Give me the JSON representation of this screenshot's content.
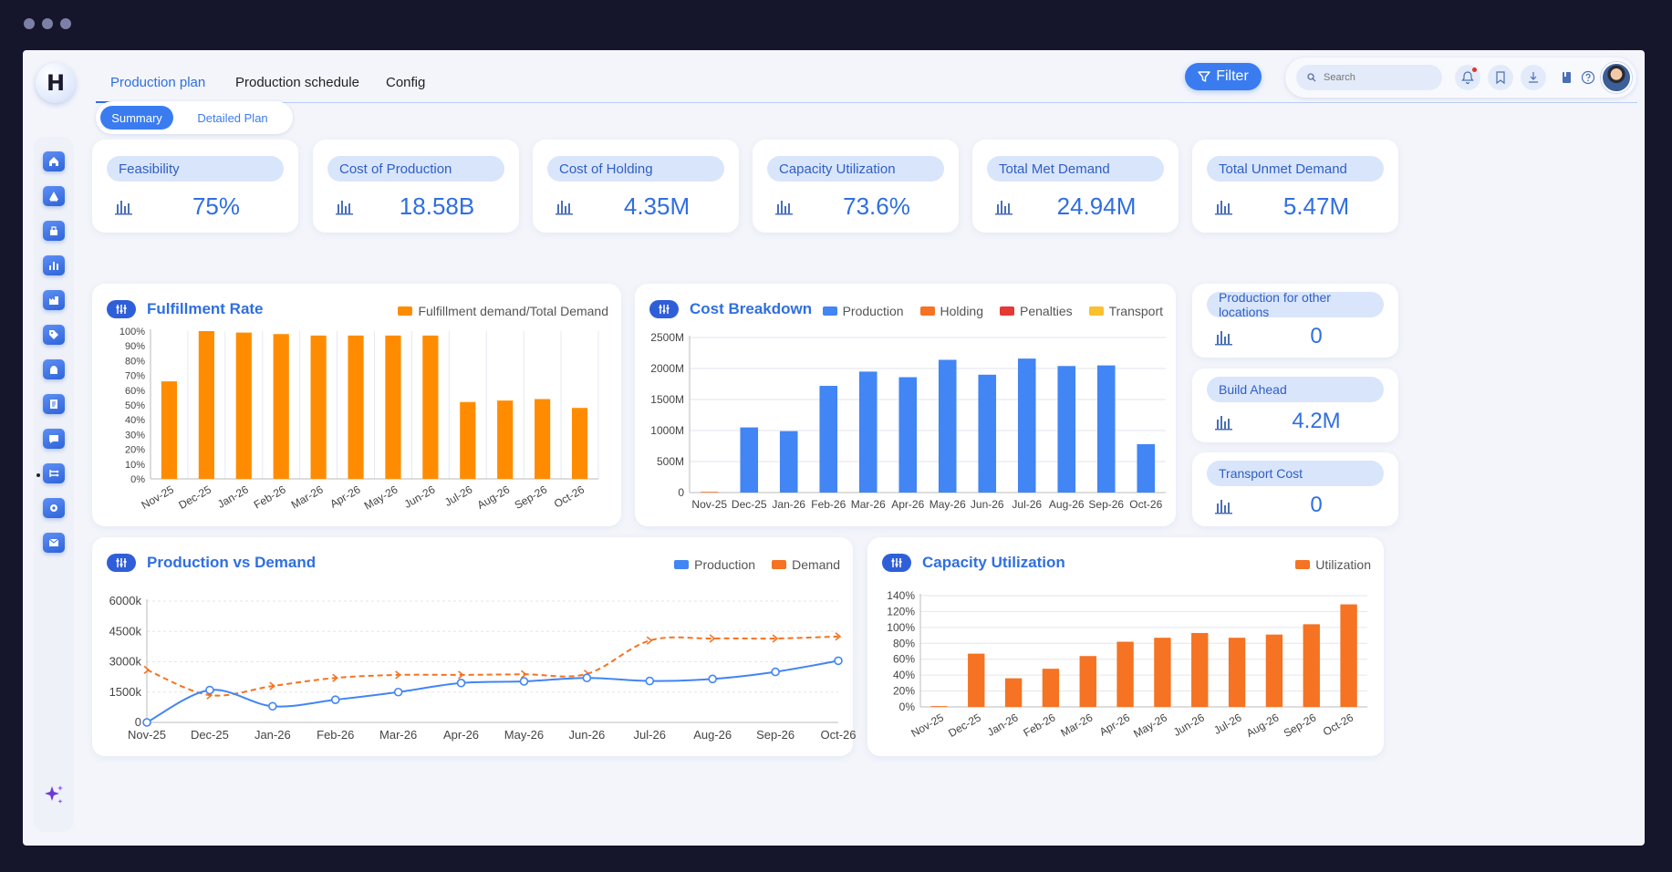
{
  "nav": {
    "logo_letter": "H",
    "tabs": [
      "Production plan",
      "Production schedule",
      "Config"
    ],
    "filter_label": "Filter",
    "search_placeholder": "Search"
  },
  "segment": {
    "active": "Summary",
    "other": "Detailed Plan"
  },
  "sidebar_icons": [
    "home-icon",
    "alert-icon",
    "inventory-icon",
    "chart-icon",
    "factory-icon",
    "tag-icon",
    "hand-icon",
    "report-icon",
    "message-icon",
    "flow-icon",
    "settings-icon",
    "mail-icon"
  ],
  "kpis": [
    {
      "label": "Feasibility",
      "value": "75%"
    },
    {
      "label": "Cost of Production",
      "value": "18.58B"
    },
    {
      "label": "Cost of Holding",
      "value": "4.35M"
    },
    {
      "label": "Capacity Utilization",
      "value": "73.6%"
    },
    {
      "label": "Total Met Demand",
      "value": "24.94M"
    },
    {
      "label": "Total Unmet Demand",
      "value": "5.47M"
    }
  ],
  "side_kpis": [
    {
      "label": "Production for other locations",
      "value": "0"
    },
    {
      "label": "Build Ahead",
      "value": "4.2M"
    },
    {
      "label": "Transport Cost",
      "value": "0"
    }
  ],
  "colors": {
    "blue": "#4285f4",
    "orange": "#ff8c00",
    "deep_orange": "#f57322",
    "red": "#e53935",
    "yellow": "#fbc02d"
  },
  "chart_data": [
    {
      "id": "fulfillment",
      "type": "bar",
      "title": "Fulfillment Rate",
      "legend": [
        "Fulfillment demand/Total Demand"
      ],
      "categories": [
        "Nov-25",
        "Dec-25",
        "Jan-26",
        "Feb-26",
        "Mar-26",
        "Apr-26",
        "May-26",
        "Jun-26",
        "Jul-26",
        "Aug-26",
        "Sep-26",
        "Oct-26"
      ],
      "series": [
        {
          "name": "Fulfillment demand/Total Demand",
          "values": [
            66,
            100,
            99,
            98,
            97,
            97,
            97,
            97,
            52,
            53,
            54,
            48
          ]
        }
      ],
      "ylim": [
        0,
        100
      ],
      "yticks": [
        "0%",
        "10%",
        "20%",
        "30%",
        "40%",
        "50%",
        "60%",
        "70%",
        "80%",
        "90%",
        "100%"
      ]
    },
    {
      "id": "cost",
      "type": "bar",
      "title": "Cost Breakdown",
      "legend": [
        "Production",
        "Holding",
        "Penalties",
        "Transport"
      ],
      "categories": [
        "Nov-25",
        "Dec-25",
        "Jan-26",
        "Feb-26",
        "Mar-26",
        "Apr-26",
        "May-26",
        "Jun-26",
        "Jul-26",
        "Aug-26",
        "Sep-26",
        "Oct-26"
      ],
      "series": [
        {
          "name": "Production",
          "values": [
            0,
            1050,
            990,
            1720,
            1950,
            1860,
            2140,
            1900,
            2160,
            2040,
            2050,
            780
          ]
        },
        {
          "name": "Holding",
          "values": [
            12,
            0,
            0,
            0,
            0,
            0,
            0,
            0,
            0,
            0,
            0,
            0
          ]
        },
        {
          "name": "Penalties",
          "values": [
            0,
            0,
            0,
            0,
            0,
            0,
            0,
            0,
            0,
            0,
            0,
            0
          ]
        },
        {
          "name": "Transport",
          "values": [
            0,
            0,
            0,
            0,
            0,
            0,
            0,
            0,
            0,
            0,
            0,
            0
          ]
        }
      ],
      "ylim": [
        0,
        2500
      ],
      "yticks": [
        "0",
        "500M",
        "1000M",
        "1500M",
        "2000M",
        "2500M"
      ]
    },
    {
      "id": "prodvsdemand",
      "type": "line",
      "title": "Production vs Demand",
      "legend": [
        "Production",
        "Demand"
      ],
      "categories": [
        "Nov-25",
        "Dec-25",
        "Jan-26",
        "Feb-26",
        "Mar-26",
        "Apr-26",
        "May-26",
        "Jun-26",
        "Jul-26",
        "Aug-26",
        "Sep-26",
        "Oct-26"
      ],
      "series": [
        {
          "name": "Production",
          "values": [
            0,
            1600,
            800,
            1120,
            1500,
            1950,
            2030,
            2200,
            2050,
            2150,
            2500,
            3050
          ]
        },
        {
          "name": "Demand",
          "values": [
            2600,
            1350,
            1800,
            2200,
            2350,
            2350,
            2380,
            2400,
            4050,
            4150,
            4150,
            4250
          ]
        }
      ],
      "ylim": [
        0,
        6000
      ],
      "yticks": [
        "0",
        "1500k",
        "3000k",
        "4500k",
        "6000k"
      ]
    },
    {
      "id": "capacity",
      "type": "bar",
      "title": "Capacity Utilization",
      "legend": [
        "Utilization"
      ],
      "categories": [
        "Nov-25",
        "Dec-25",
        "Jan-26",
        "Feb-26",
        "Mar-26",
        "Apr-26",
        "May-26",
        "Jun-26",
        "Jul-26",
        "Aug-26",
        "Sep-26",
        "Oct-26"
      ],
      "series": [
        {
          "name": "Utilization",
          "values": [
            1,
            67,
            36,
            48,
            64,
            82,
            87,
            93,
            87,
            91,
            104,
            129
          ]
        }
      ],
      "ylim": [
        0,
        140
      ],
      "yticks": [
        "0%",
        "20%",
        "40%",
        "60%",
        "80%",
        "100%",
        "120%",
        "140%"
      ]
    }
  ]
}
